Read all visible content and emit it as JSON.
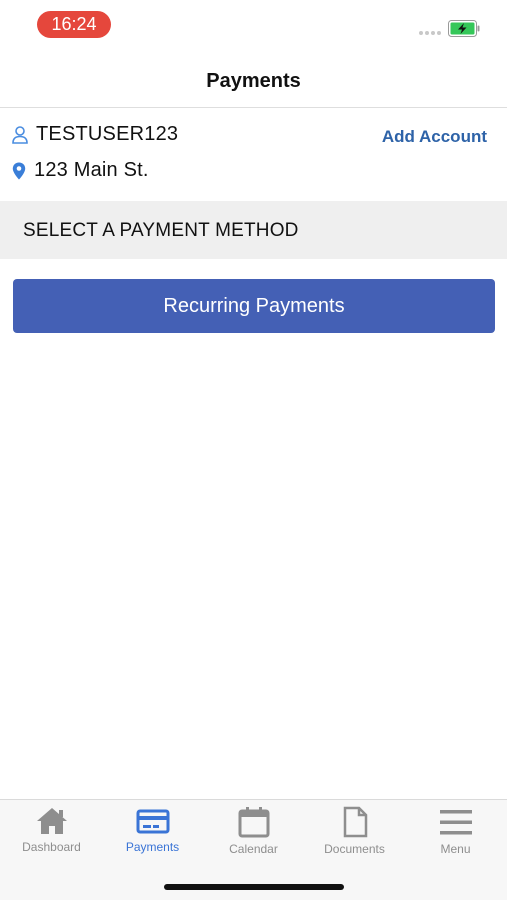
{
  "status_bar": {
    "time": "16:24",
    "time_pill_color": "#e5473c",
    "battery_icon": "battery-charging-icon",
    "battery_color": "#35c759"
  },
  "header": {
    "title": "Payments"
  },
  "account": {
    "user_icon": "user-icon",
    "username": "TESTUSER123",
    "location_icon": "location-pin-icon",
    "address": "123 Main St.",
    "add_account_label": "Add Account",
    "link_color": "#2e63a8"
  },
  "section": {
    "label": "SELECT A PAYMENT METHOD"
  },
  "recurring_button": {
    "label": "Recurring Payments",
    "color": "#4460b5"
  },
  "tab_bar": {
    "active_color": "#3a74d6",
    "inactive_color": "#8e8e8e",
    "tabs": [
      {
        "label": "Dashboard",
        "icon": "home-icon",
        "active": false
      },
      {
        "label": "Payments",
        "icon": "credit-card-icon",
        "active": true
      },
      {
        "label": "Calendar",
        "icon": "calendar-icon",
        "active": false
      },
      {
        "label": "Documents",
        "icon": "document-icon",
        "active": false
      },
      {
        "label": "Menu",
        "icon": "hamburger-menu-icon",
        "active": false
      }
    ]
  }
}
